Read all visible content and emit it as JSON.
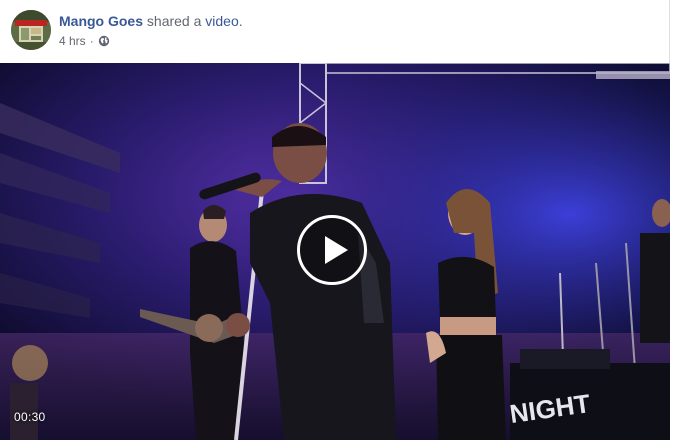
{
  "post": {
    "author": "Mango Goes",
    "action": "shared a",
    "object_link": "video",
    "punctuation": ".",
    "time": "4 hrs",
    "separator": "·",
    "privacy_icon": "globe-icon"
  },
  "video": {
    "duration": "00:30",
    "play_icon": "play-icon",
    "overlay_sign_text": "NIGHT"
  },
  "colors": {
    "link": "#385898",
    "text": "#1d2129",
    "secondary": "#616770",
    "stage_bg": "#0b0c2a",
    "stage_purple": "#5a2fa8",
    "stage_blue": "#2a2fb0"
  }
}
